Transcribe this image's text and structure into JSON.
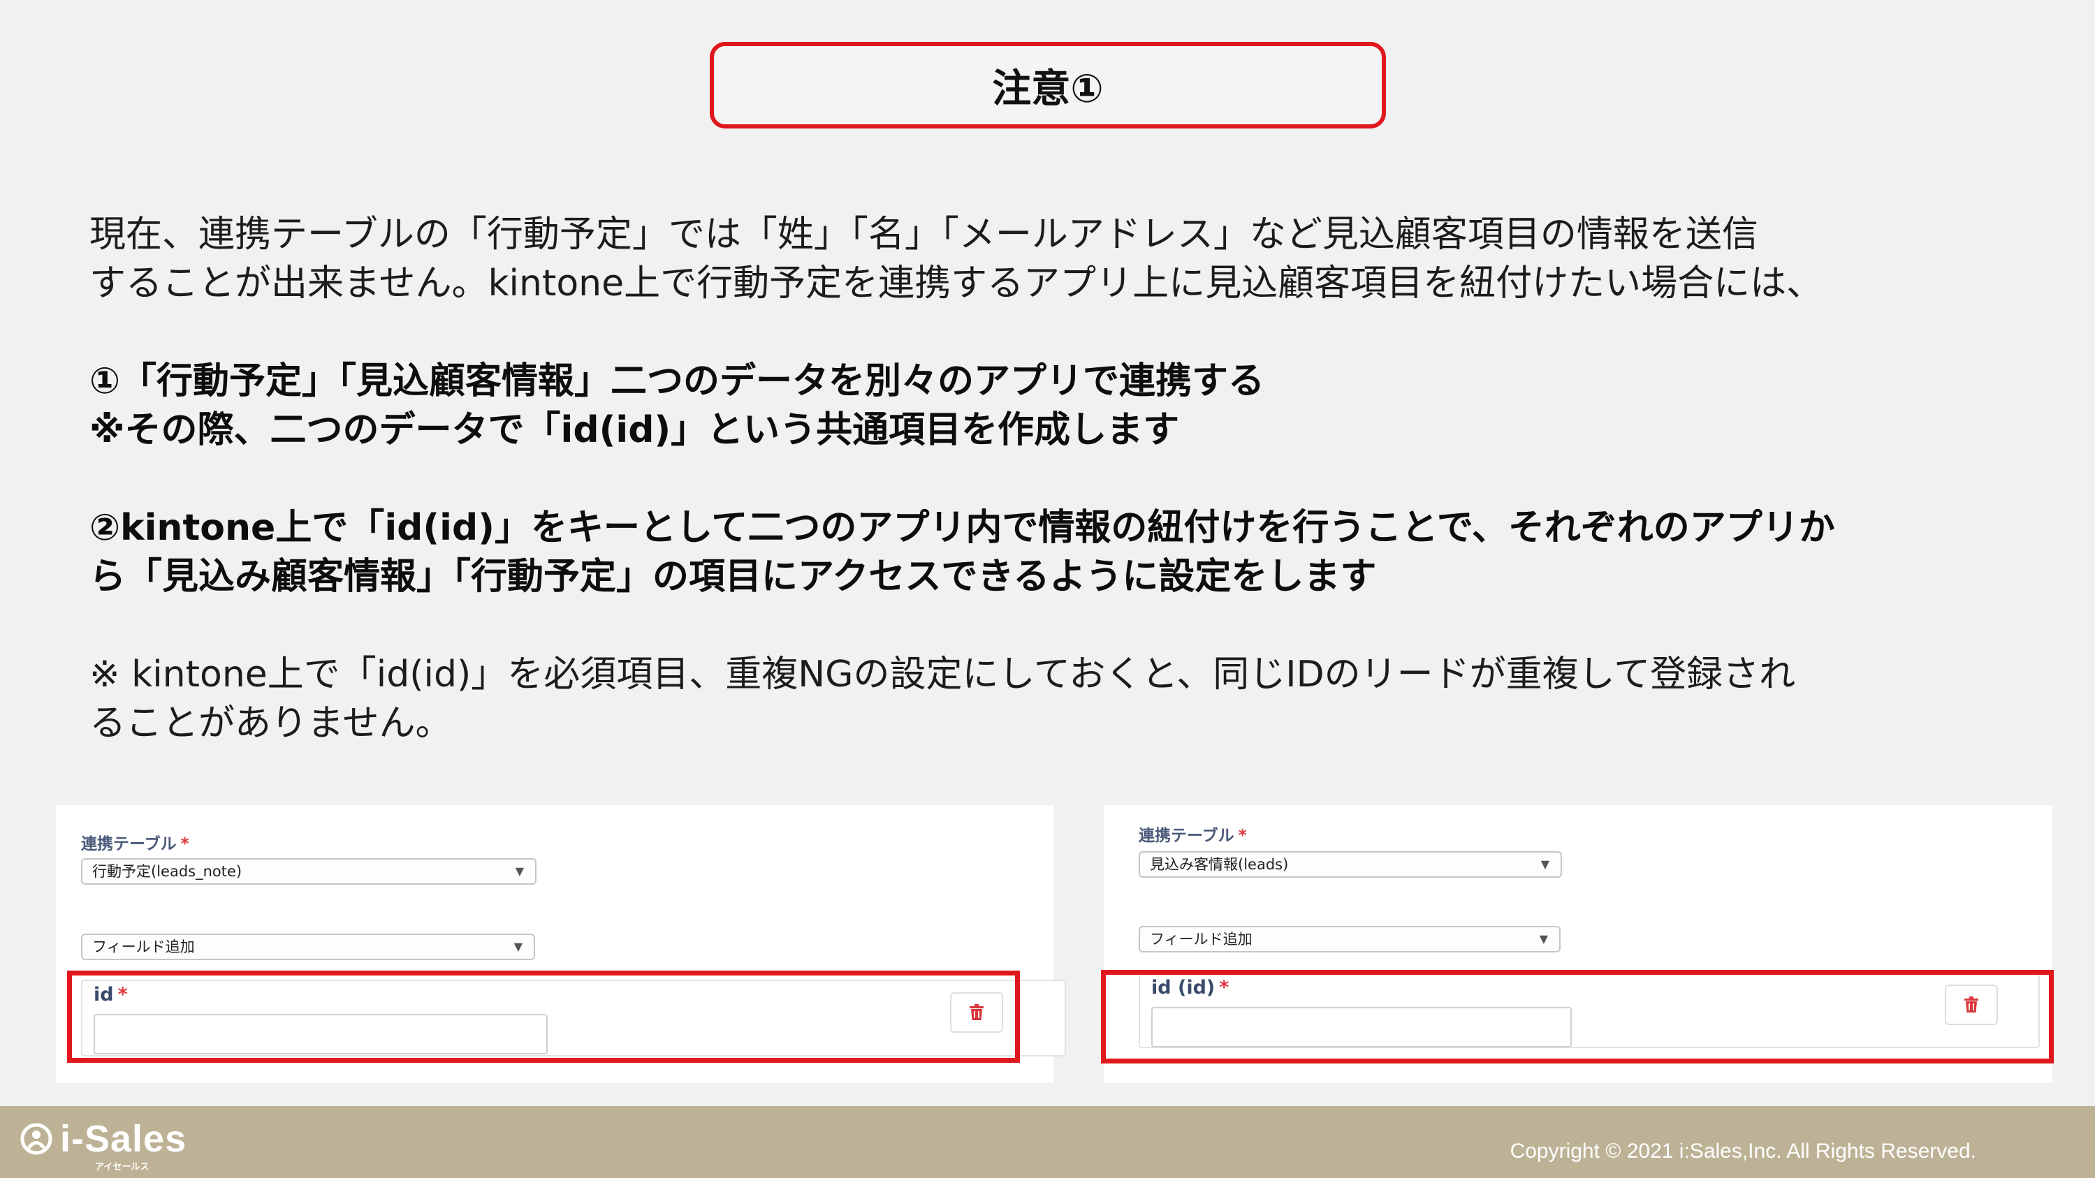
{
  "slide": {
    "title": "注意①",
    "para1": [
      "現在、連携テーブルの「行動予定」では「姓」「名」「メールアドレス」など見込顧客項目の情報を送信",
      "することが出来ません。kintone上で行動予定を連携するアプリ上に見込顧客項目を紐付けたい場合には、"
    ],
    "para2": [
      "①「行動予定」「見込顧客情報」二つのデータを別々のアプリで連携する",
      "※その際、二つのデータで「id(id)」という共通項目を作成します"
    ],
    "para3": [
      "②kintone上で「id(id)」をキーとして二つのアプリ内で情報の紐付けを行うことで、それぞれのアプリか",
      "ら「見込み顧客情報」「行動予定」の項目にアクセスできるように設定をします"
    ],
    "para4": [
      "※ kintone上で「id(id)」を必須項目、重複NGの設定にしておくと、同じIDのリードが重複して登録され",
      "ることがありません。"
    ]
  },
  "panel_left": {
    "table_label": "連携テーブル",
    "required_mark": "*",
    "table_select": "行動予定(leads_note)",
    "field_add_select": "フィールド追加",
    "field_name": "id"
  },
  "panel_right": {
    "table_label": "連携テーブル",
    "required_mark": "*",
    "table_select": "見込み客情報(leads)",
    "field_add_select": "フィールド追加",
    "field_name": "id (id)"
  },
  "footer": {
    "logo_text": "i-Sales",
    "logo_sub": "アイセールス",
    "copyright": "Copyright © 2021 i:Sales,Inc. All Rights Reserved."
  },
  "colors": {
    "accent_red": "#e0171c",
    "footer_bg": "#bdb295",
    "page_bg": "#f1f1f1"
  },
  "icons": {
    "trash": "trash-icon",
    "caret": "caret-down-icon",
    "logo": "person-circle-icon"
  }
}
